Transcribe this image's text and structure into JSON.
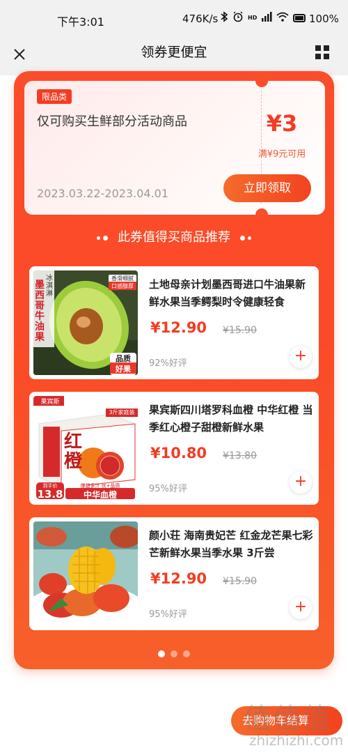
{
  "status_bar": {
    "time": "下午3:01",
    "speed": "476K/s",
    "icons": [
      "bluetooth-icon",
      "alarm-icon",
      "hd-signal-icon",
      "signal-icon",
      "wifi-icon",
      "battery-icon"
    ],
    "hd_label": "HD",
    "battery": "100%"
  },
  "header": {
    "title": "领券更便宜",
    "close_icon": "close-icon",
    "menu_icon": "grid-icon"
  },
  "coupon": {
    "tag": "限品类",
    "description": "仅可购买生鲜部分活动商品",
    "amount": "¥3",
    "condition": "满¥9元可用",
    "date_range": "2023.03.22-2023.04.01",
    "claim_label": "立即领取"
  },
  "section_title": "此券值得买商品推荐",
  "products": [
    {
      "title": "土地母亲计划墨西哥进口牛油果新鲜水果当季鳄梨时令健康轻食",
      "price": "¥12.90",
      "original_price": "¥15.90",
      "rating": "92%好评",
      "image": {
        "side_text": "墨西哥牛油果",
        "corner_text": "冰淇淋",
        "badge_text": "香滑细腻",
        "badge_text2": "口感醇厚",
        "quality_text": "品质",
        "quality_text2": "好果"
      }
    },
    {
      "title": "果宾斯四川塔罗科血橙 中华红橙 当季红心橙子甜橙新鲜水果",
      "price": "¥10.80",
      "original_price": "¥13.80",
      "rating": "95%好评",
      "image": {
        "brand": "果宾斯",
        "box_label": "3斤家庭装",
        "big_text": "红橙",
        "price_tag_label": "到手价",
        "price_tag_value": "13.8",
        "banner_small": "爆甜多汁 优+品质",
        "banner": "中华血橙"
      }
    },
    {
      "title": "颜小荘 海南贵妃芒 红金龙芒果七彩芒新鲜水果当季水果 3斤尝",
      "price": "¥12.90",
      "original_price": "¥15.90",
      "rating": "95%好评",
      "image": {}
    }
  ],
  "pagination": {
    "total": 3,
    "active": 1
  },
  "cart_button": {
    "label": "去购物车结算"
  },
  "watermark": {
    "logo": "值值值",
    "url": "zhizhizhi.com"
  },
  "colors": {
    "accent": "#f33c22",
    "panel": "#fb4d2a",
    "header_bg": "#f1f1f1"
  }
}
